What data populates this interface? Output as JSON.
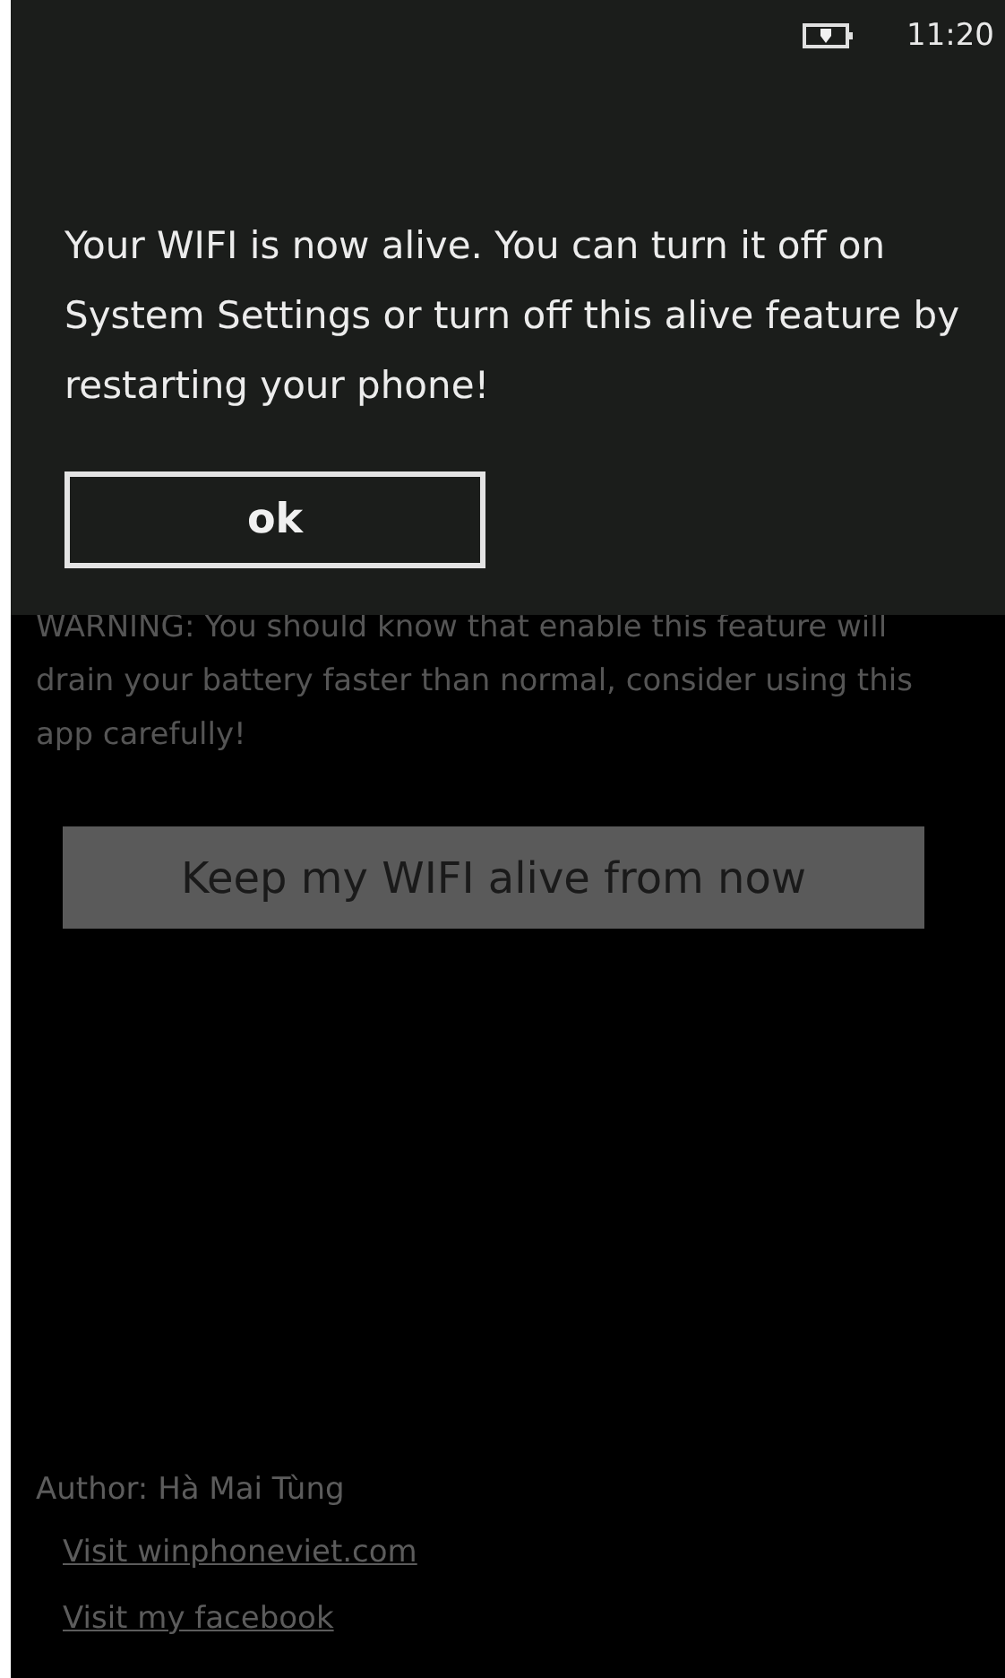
{
  "status_bar": {
    "time": "11:20"
  },
  "dialog": {
    "message": "Your WIFI is now alive. You can turn it off on System Settings or turn off this alive feature by restarting your phone!",
    "button": "ok"
  },
  "warning": "WARNING: You should know that enable this feature will drain your battery faster than normal, consider using this app carefully!",
  "action_button": "Keep my WIFI alive from now",
  "author": "Author: Hà Mai Tùng",
  "links": [
    "Visit winphoneviet.com",
    "Visit my facebook"
  ]
}
